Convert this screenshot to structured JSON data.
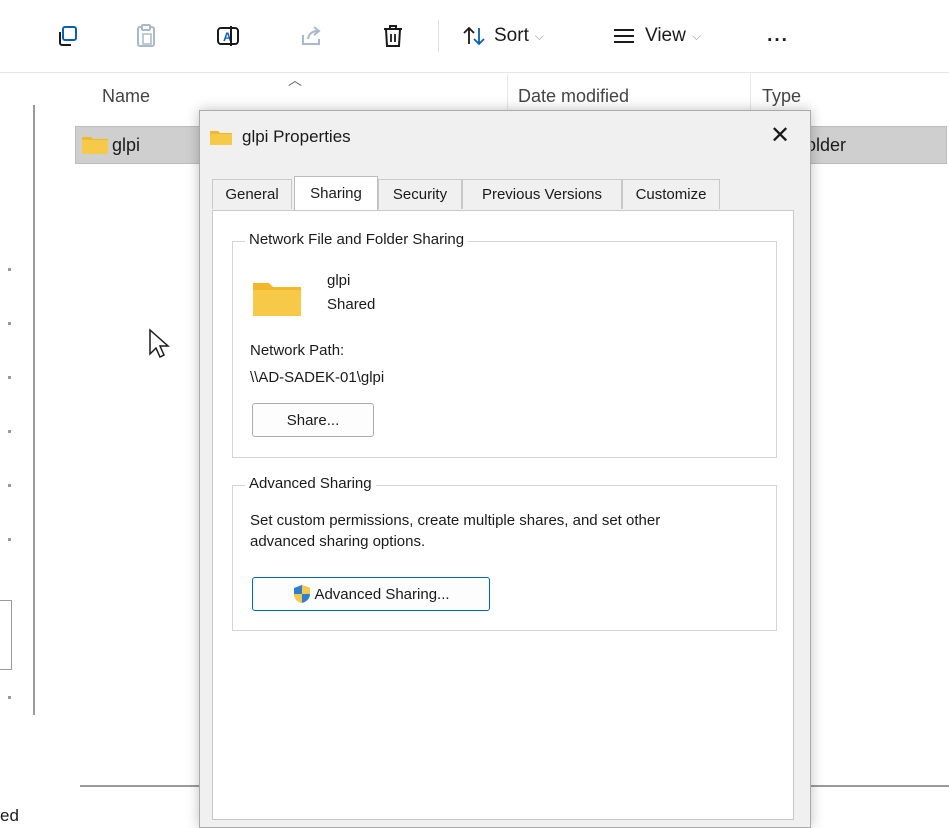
{
  "toolbar": {
    "items": [
      {
        "name": "copy-icon"
      },
      {
        "name": "paste-icon"
      },
      {
        "name": "rename-icon"
      },
      {
        "name": "share-icon"
      },
      {
        "name": "delete-icon"
      }
    ],
    "sort_label": "Sort",
    "view_label": "View",
    "more_label": "..."
  },
  "columns": {
    "name": "Name",
    "date_modified": "Date modified",
    "type": "Type"
  },
  "file_row": {
    "name": "glpi",
    "type_fragment": "older"
  },
  "status_fragment": "ed",
  "dialog": {
    "title": "glpi Properties",
    "close_glyph": "✕",
    "tabs": [
      {
        "label": "General"
      },
      {
        "label": "Sharing"
      },
      {
        "label": "Security"
      },
      {
        "label": "Previous Versions"
      },
      {
        "label": "Customize"
      }
    ],
    "active_tab": "Sharing",
    "network_group": {
      "legend": "Network File and Folder Sharing",
      "folder_name": "glpi",
      "folder_state": "Shared",
      "path_label": "Network Path:",
      "path_value": "\\\\AD-SADEK-01\\glpi",
      "share_button": "Share..."
    },
    "advanced_group": {
      "legend": "Advanced Sharing",
      "description_line1": "Set custom permissions, create multiple shares, and set other",
      "description_line2": "advanced sharing options.",
      "button": "Advanced Sharing..."
    }
  },
  "colors": {
    "accent": "#0067c0",
    "folder": "#f7c948",
    "selection": "#cfcfcf"
  }
}
